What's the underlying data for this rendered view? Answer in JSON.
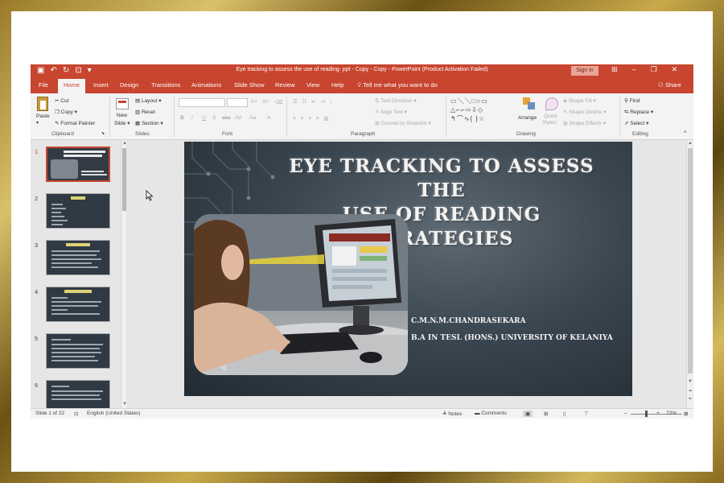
{
  "window": {
    "title": "Eye tracking to assess the use of reading- ppt - Copy - Copy  -  PowerPoint (Product Activation Failed)",
    "sign_in": "Sign in"
  },
  "tabs": [
    "File",
    "Home",
    "Insert",
    "Design",
    "Transitions",
    "Animations",
    "Slide Show",
    "Review",
    "View",
    "Help"
  ],
  "active_tab": "Home",
  "tell_me": "Tell me what you want to do",
  "share": "Share",
  "ribbon": {
    "clipboard": {
      "label": "Clipboard",
      "paste": "Paste",
      "cut": "Cut",
      "copy": "Copy",
      "format_painter": "Format Painter"
    },
    "slides": {
      "label": "Slides",
      "new_slide": "New",
      "new_slide_2": "Slide",
      "layout": "Layout",
      "reset": "Reset",
      "section": "Section"
    },
    "font": {
      "label": "Font",
      "grow": "A",
      "shrink": "A",
      "bold": "B",
      "italic": "I",
      "underline": "U",
      "strike": "S",
      "abc": "abc",
      "spacing": "AV",
      "case": "Aa",
      "color": "A"
    },
    "paragraph": {
      "label": "Paragraph",
      "text_direction": "Text Direction",
      "align_text": "Align Text",
      "convert_smartart": "Convert to SmartArt"
    },
    "drawing": {
      "label": "Drawing",
      "arrange": "Arrange",
      "quick_styles": "Quick",
      "quick_styles_2": "Styles",
      "shape_fill": "Shape Fill",
      "shape_outline": "Shape Outline",
      "shape_effects": "Shape Effects"
    },
    "editing": {
      "label": "Editing",
      "find": "Find",
      "replace": "Replace",
      "select": "Select"
    }
  },
  "thumbnails": [
    {
      "number": "1",
      "active": true
    },
    {
      "number": "2",
      "active": false
    },
    {
      "number": "3",
      "active": false
    },
    {
      "number": "4",
      "active": false
    },
    {
      "number": "5",
      "active": false
    },
    {
      "number": "6",
      "active": false
    }
  ],
  "slide": {
    "title_line1": "EYE TRACKING TO ASSESS THE",
    "title_line2": "USE OF READING STRATEGIES",
    "author": "C.M.N.M.CHANDRASEKARA",
    "affiliation": "B.A IN TESL (HONS.) UNIVERSITY OF KELANIYA"
  },
  "status": {
    "slide_count": "Slide 1 of 22",
    "language": "English (United States)",
    "notes": "Notes",
    "comments": "Comments",
    "zoom": "72%"
  },
  "colors": {
    "accent": "#c8452f",
    "frame_gold": "#b8963a",
    "slide_bg": "#3a4650"
  }
}
